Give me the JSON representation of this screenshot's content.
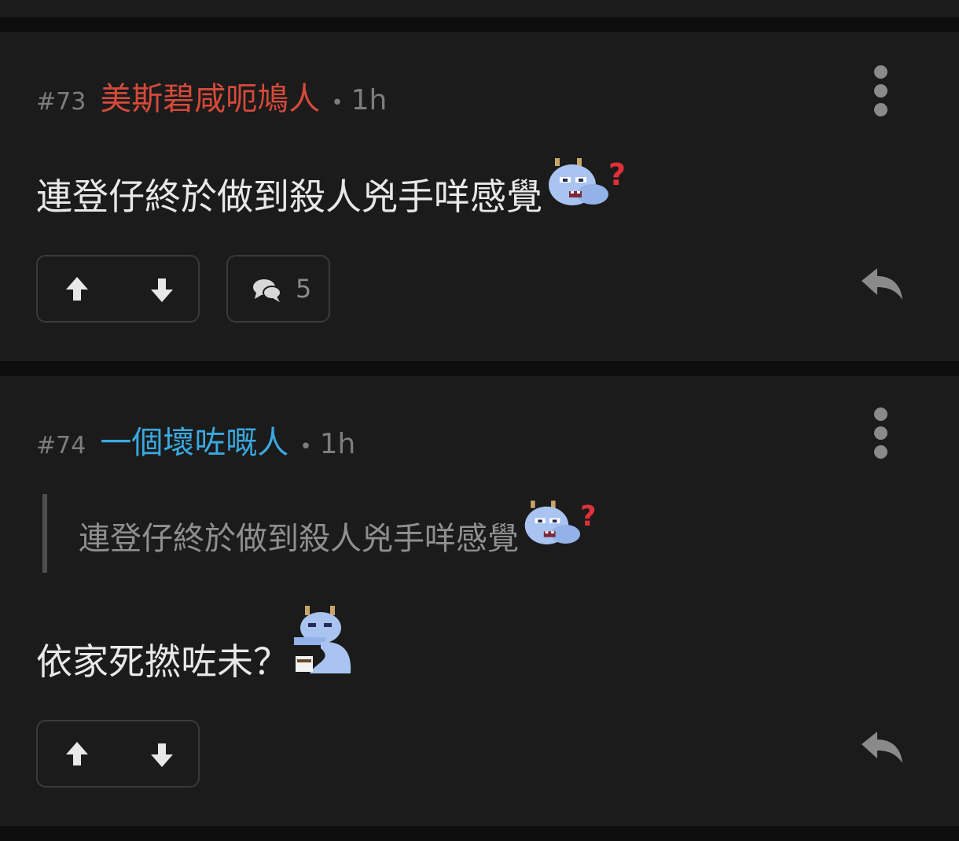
{
  "posts": [
    {
      "number": "#73",
      "username": "美斯碧咸呃鳩人",
      "username_color": "#d64a3a",
      "separator": "•",
      "time": "1h",
      "content": "連登仔終於做到殺人兇手咩感覺",
      "sticker": "confused-dragon-sticker",
      "comment_count": "5"
    },
    {
      "number": "#74",
      "username": "一個壞咗嘅人",
      "username_color": "#3aa9e0",
      "separator": "•",
      "time": "1h",
      "quote": "連登仔終於做到殺人兇手咩感覺",
      "quote_sticker": "confused-dragon-sticker",
      "content": "依家死撚咗未？",
      "sticker": "tea-drinking-dragon-sticker"
    }
  ],
  "icons": {
    "more": "more-vertical-icon",
    "upvote": "arrow-up-icon",
    "downvote": "arrow-down-icon",
    "comment": "comments-icon",
    "reply": "reply-icon"
  },
  "colors": {
    "background": "#1b1b1b",
    "separator_band": "#0e0e0e",
    "text": "#e8e8e8",
    "muted": "#7d7d7d",
    "icon": "#8a8a8a",
    "border": "#3a3a3a"
  }
}
